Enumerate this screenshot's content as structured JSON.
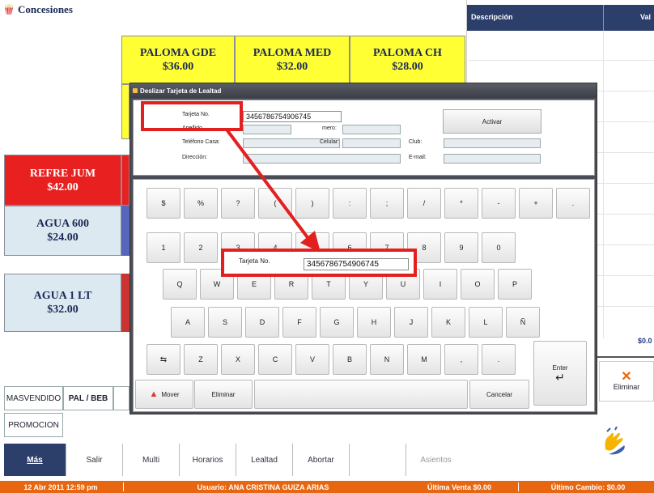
{
  "app": {
    "title": "Concesiones"
  },
  "products_top": [
    {
      "name": "PALOMA GDE",
      "price": "$36.00"
    },
    {
      "name": "PALOMA MED",
      "price": "$32.00"
    },
    {
      "name": "PALOMA CH",
      "price": "$28.00"
    }
  ],
  "products_left": [
    {
      "name": "REFRE JUM",
      "price": "$42.00"
    },
    {
      "name": "AGUA 600",
      "price": "$24.00"
    },
    {
      "name": "AGUA 1 LT",
      "price": "$32.00"
    }
  ],
  "categories": [
    "MASVENDIDO",
    "PAL / BEB",
    "PROMOCION"
  ],
  "order_table": {
    "col_description": "Descripción",
    "col_value": "Val",
    "total": "$0.0"
  },
  "eliminar_label": "Eliminar",
  "bottom_bar": [
    "Más",
    "Salir",
    "Multi",
    "Horarios",
    "Lealtad",
    "Abortar",
    "Asientos"
  ],
  "footer": {
    "datetime": "12 Abr 2011 12:59 pm",
    "user": "Usuario: ANA CRISTINA GUIZA ARIAS",
    "last_sale": "Última Venta $0.00",
    "last_change": "Último Cambio: $0.00"
  },
  "dialog": {
    "title": "Deslizar Tarjeta de Lealtad",
    "labels": {
      "card": "Tarjeta No.",
      "surname": "Apellido",
      "number": "mero:",
      "phone": "Teléfono Casa:",
      "mobile": "Celular:",
      "club": "Club:",
      "address": "Dirección:",
      "email": "E-mail:"
    },
    "card_value": "3456786754906745",
    "activate_label": "Activar",
    "zoom_label": "Tarjeta No.",
    "zoom_value": "3456786754906745",
    "keys_row1": [
      "$",
      "%",
      "?",
      "(",
      ")",
      ":",
      ";",
      "/",
      "*",
      "-",
      "+",
      "."
    ],
    "keys_row2": [
      "1",
      "2",
      "3",
      "4",
      "5",
      "6",
      "7",
      "8",
      "9",
      "0"
    ],
    "keys_row3": [
      "Q",
      "W",
      "E",
      "R",
      "T",
      "Y",
      "U",
      "I",
      "O",
      "P"
    ],
    "keys_row4": [
      "A",
      "S",
      "D",
      "F",
      "G",
      "H",
      "J",
      "K",
      "L",
      "Ñ"
    ],
    "keys_row5": [
      "Z",
      "X",
      "C",
      "V",
      "B",
      "N",
      "M",
      ",",
      "."
    ],
    "enter_label": "Enter",
    "move_label": "Mover",
    "delete_label": "Eliminar",
    "cancel_label": "Cancelar"
  },
  "colors": {
    "brand_red": "#cc2222",
    "footer_orange": "#e8660f",
    "header_navy": "#2c3e6a",
    "dialog_gray": "#4a4d55",
    "product_yellow": "#ffff33"
  }
}
